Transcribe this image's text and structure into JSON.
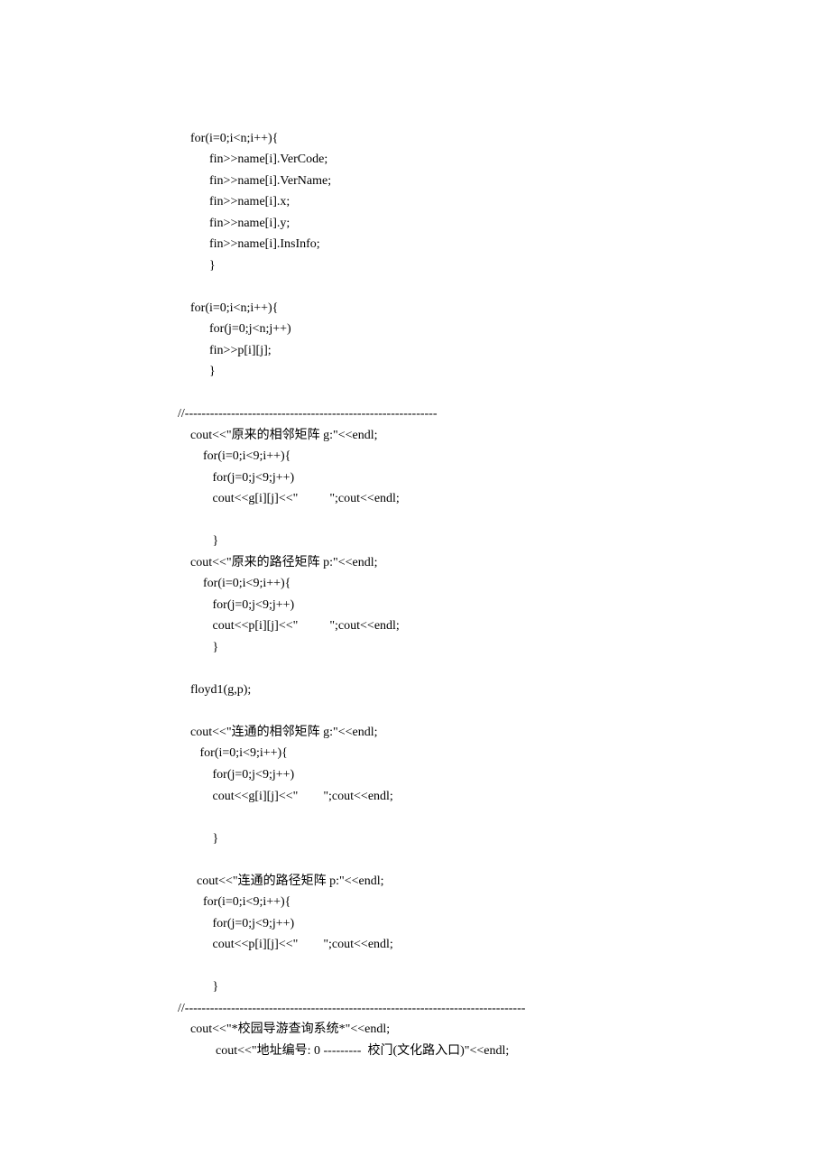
{
  "code": {
    "l01": "    for(i=0;i<n;i++){",
    "l02": "          fin>>name[i].VerCode;",
    "l03": "          fin>>name[i].VerName;",
    "l04": "          fin>>name[i].x;",
    "l05": "          fin>>name[i].y;",
    "l06": "          fin>>name[i].InsInfo;",
    "l07": "          }",
    "l08": "",
    "l09": "    for(i=0;i<n;i++){",
    "l10": "          for(j=0;j<n;j++)",
    "l11": "          fin>>p[i][j];",
    "l12": "          }",
    "l13": "",
    "l14": "//------------------------------------------------------------",
    "l15": "    cout<<\"原来的相邻矩阵 g:\"<<endl;",
    "l16": "        for(i=0;i<9;i++){",
    "l17": "           for(j=0;j<9;j++)",
    "l18": "           cout<<g[i][j]<<\"          \";cout<<endl;",
    "l19": "",
    "l20": "           }",
    "l21": "    cout<<\"原来的路径矩阵 p:\"<<endl;",
    "l22": "        for(i=0;i<9;i++){",
    "l23": "           for(j=0;j<9;j++)",
    "l24": "           cout<<p[i][j]<<\"          \";cout<<endl;",
    "l25": "           }",
    "l26": "",
    "l27": "    floyd1(g,p);",
    "l28": "",
    "l29": "    cout<<\"连通的相邻矩阵 g:\"<<endl;",
    "l30": "       for(i=0;i<9;i++){",
    "l31": "           for(j=0;j<9;j++)",
    "l32": "           cout<<g[i][j]<<\"        \";cout<<endl;",
    "l33": "",
    "l34": "           }",
    "l35": "",
    "l36": "      cout<<\"连通的路径矩阵 p:\"<<endl;",
    "l37": "        for(i=0;i<9;i++){",
    "l38": "           for(j=0;j<9;j++)",
    "l39": "           cout<<p[i][j]<<\"        \";cout<<endl;",
    "l40": "",
    "l41": "           }",
    "l42": "//---------------------------------------------------------------------------------",
    "l43": "    cout<<\"*校园导游查询系统*\"<<endl;",
    "l44": "            cout<<\"地址编号: 0 ---------  校门(文化路入口)\"<<endl;"
  }
}
